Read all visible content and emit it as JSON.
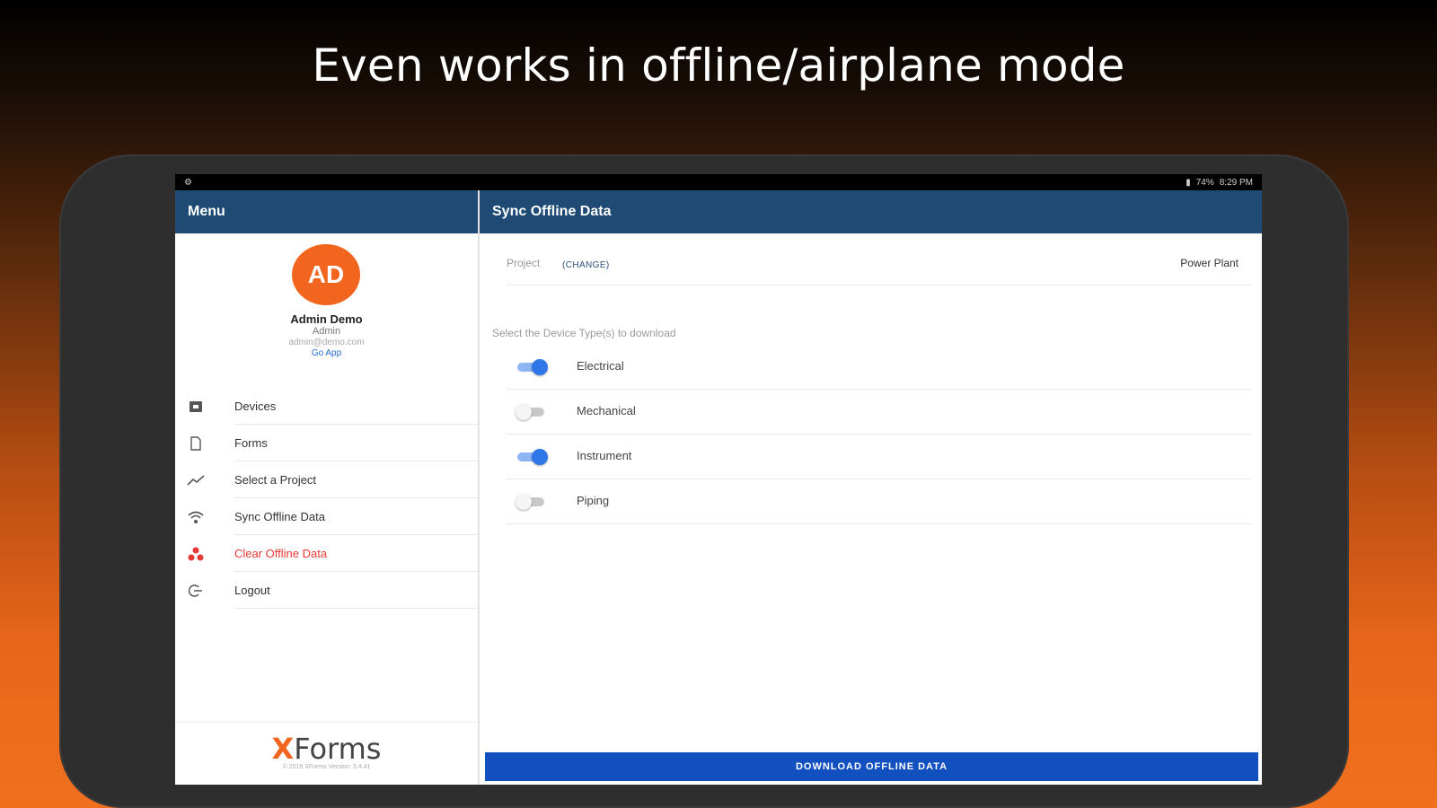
{
  "headline": "Even works in offline/airplane mode",
  "status_bar": {
    "left_icon": "settings-icon",
    "indicators": "74%",
    "time": "8:29 PM"
  },
  "sidebar": {
    "title": "Menu",
    "user": {
      "initials": "AD",
      "name": "Admin Demo",
      "role": "Admin",
      "email": "admin@demo.com",
      "link": "Go App"
    },
    "items": [
      {
        "label": "Devices",
        "icon": "devices-icon"
      },
      {
        "label": "Forms",
        "icon": "forms-icon"
      },
      {
        "label": "Select a Project",
        "icon": "project-icon"
      },
      {
        "label": "Sync Offline Data",
        "icon": "wifi-sync-icon"
      },
      {
        "label": "Clear Offline Data",
        "icon": "clear-icon"
      },
      {
        "label": "Logout",
        "icon": "logout-icon"
      }
    ],
    "brand": {
      "logo_x": "X",
      "logo_rest": "Forms",
      "copyright": "© 2019 XForms Version: 3.4.41"
    }
  },
  "main": {
    "title": "Sync Offline Data",
    "project": {
      "label": "Project",
      "change": "(CHANGE)",
      "value": "Power Plant"
    },
    "section_label": "Select the Device Type(s) to download",
    "device_types": [
      {
        "label": "Electrical",
        "enabled": true
      },
      {
        "label": "Mechanical",
        "enabled": false
      },
      {
        "label": "Instrument",
        "enabled": true
      },
      {
        "label": "Piping",
        "enabled": false
      }
    ],
    "download_button": "DOWNLOAD OFFLINE DATA"
  },
  "colors": {
    "header_bar": "#1e4a73",
    "avatar": "#f2651e",
    "toggle_on": "#2f76e8",
    "danger": "#e53935",
    "download_button": "#1250c0"
  }
}
